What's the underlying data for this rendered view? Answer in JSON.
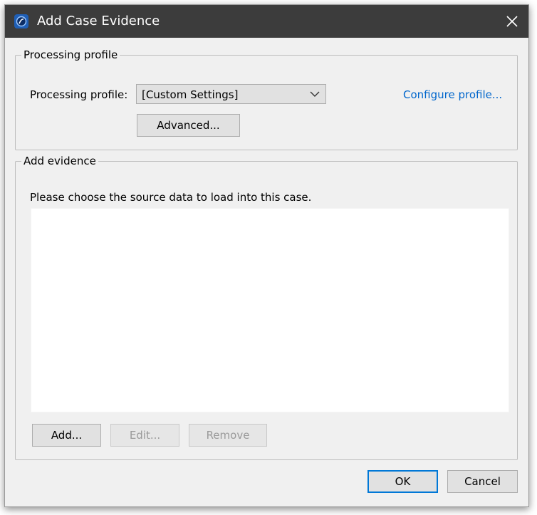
{
  "window": {
    "title": "Add Case Evidence",
    "app_icon": "app-logo-icon",
    "close_icon": "close-icon"
  },
  "processing_group": {
    "legend": "Processing profile",
    "profile_label": "Processing profile:",
    "profile_value": "[Custom Settings]",
    "advanced_button": "Advanced...",
    "configure_link": "Configure profile..."
  },
  "evidence_group": {
    "legend": "Add evidence",
    "instructions": "Please choose the source data to load into this case.",
    "source_items": [],
    "add_button": "Add...",
    "edit_button": "Edit...",
    "remove_button": "Remove"
  },
  "footer": {
    "ok_button": "OK",
    "cancel_button": "Cancel"
  },
  "colors": {
    "titlebar": "#3c3c3c",
    "dialog_bg": "#f0f0f0",
    "link": "#0066cc",
    "default_button_border": "#0078d7"
  }
}
